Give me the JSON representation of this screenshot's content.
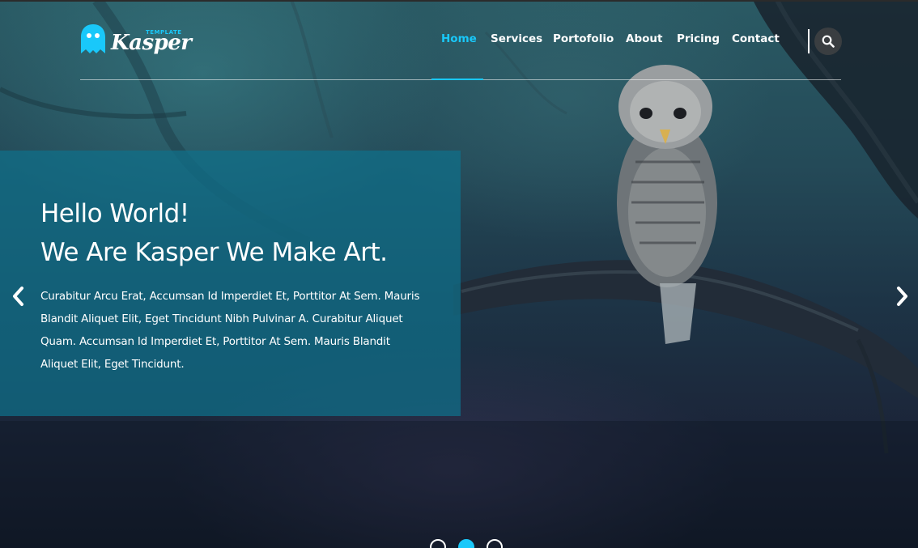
{
  "brand": {
    "tagline": "TEMPLATE",
    "name": "Kasper",
    "logo_icon": "ghost-icon",
    "accent_color": "#19c8fa"
  },
  "nav": {
    "items": [
      {
        "label": "Home",
        "active": true
      },
      {
        "label": "Services",
        "active": false
      },
      {
        "label": "Portofolio",
        "active": false
      },
      {
        "label": "About",
        "active": false
      },
      {
        "label": "Pricing",
        "active": false
      },
      {
        "label": "Contact",
        "active": false
      }
    ],
    "search_icon": "search-icon"
  },
  "hero": {
    "headline_line1": "Hello World!",
    "headline_line2": "We Are Kasper We Make Art.",
    "body": "Curabitur Arcu Erat, Accumsan Id Imperdiet Et, Porttitor At Sem. Mauris Blandit Aliquet Elit, Eget Tincidunt Nibh Pulvinar A. Curabitur Aliquet Quam. Accumsan Id Imperdiet Et, Porttitor At Sem. Mauris Blandit Aliquet Elit, Eget Tincidunt.",
    "box_color": "#0f708a",
    "prev_icon": "chevron-left-icon",
    "next_icon": "chevron-right-icon"
  },
  "slider": {
    "dots": [
      {
        "active": false
      },
      {
        "active": true
      },
      {
        "active": false
      }
    ]
  }
}
